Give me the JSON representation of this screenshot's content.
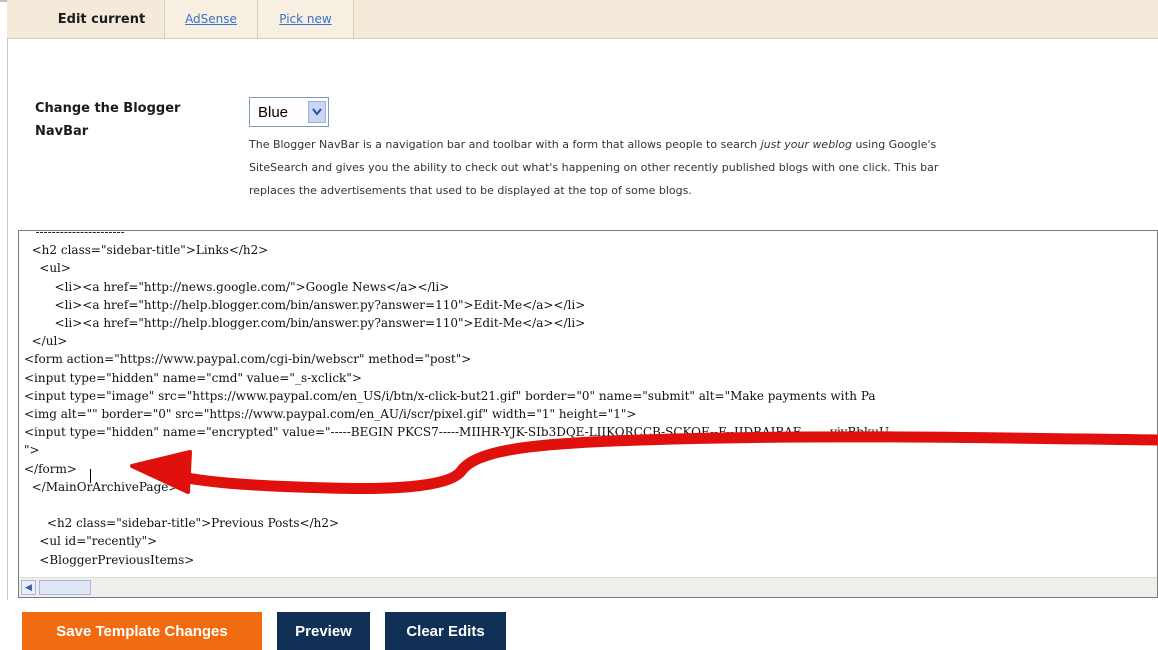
{
  "tabs": [
    {
      "label": "Edit current",
      "active": true
    },
    {
      "label": "AdSense",
      "active": false
    },
    {
      "label": "Pick new",
      "active": false
    }
  ],
  "navbar": {
    "title": "Change the Blogger NavBar",
    "selected_color": "Blue",
    "description_before": "The Blogger NavBar is a navigation bar and toolbar with a form that allows people to search ",
    "description_emph": "just your weblog",
    "description_after": " using Google's SiteSearch and gives you the ability to check out what's happening on other recently published blogs with one click. This bar replaces the advertisements that used to be displayed at the top of some blogs."
  },
  "code_lines": [
    "   ----------------------",
    "  <h2 class=\"sidebar-title\">Links</h2>",
    "    <ul>",
    "        <li><a href=\"http://news.google.com/\">Google News</a></li>",
    "        <li><a href=\"http://help.blogger.com/bin/answer.py?answer=110\">Edit-Me</a></li>",
    "        <li><a href=\"http://help.blogger.com/bin/answer.py?answer=110\">Edit-Me</a></li>",
    "  </ul>",
    "<form action=\"https://www.paypal.com/cgi-bin/webscr\" method=\"post\">",
    "<input type=\"hidden\" name=\"cmd\" value=\"_s-xclick\">",
    "<input type=\"image\" src=\"https://www.paypal.com/en_US/i/btn/x-click-but21.gif\" border=\"0\" name=\"submit\" alt=\"Make payments with Pa",
    "<img alt=\"\" border=\"0\" src=\"https://www.paypal.com/en_AU/i/scr/pixel.gif\" width=\"1\" height=\"1\">",
    "<input type=\"hidden\" name=\"encrypted\" value=\"-----BEGIN PKCS7-----MIIHR-YJK-SIb3DQE-LIIKORCCB-SCKOE--F--IIDBAIBAE-------yjyBbkuU",
    "\">",
    "</form>",
    "  </MainOrArchivePage>",
    "",
    "      <h2 class=\"sidebar-title\">Previous Posts</h2>",
    "    <ul id=\"recently\">",
    "    <BloggerPreviousItems>"
  ],
  "buttons": {
    "save": "Save Template Changes",
    "preview": "Preview",
    "clear": "Clear Edits"
  },
  "colors": {
    "annotation_arrow": "#e0110d",
    "save_button": "#f26b11",
    "dark_button": "#0f2f55",
    "link": "#3a72c7"
  }
}
